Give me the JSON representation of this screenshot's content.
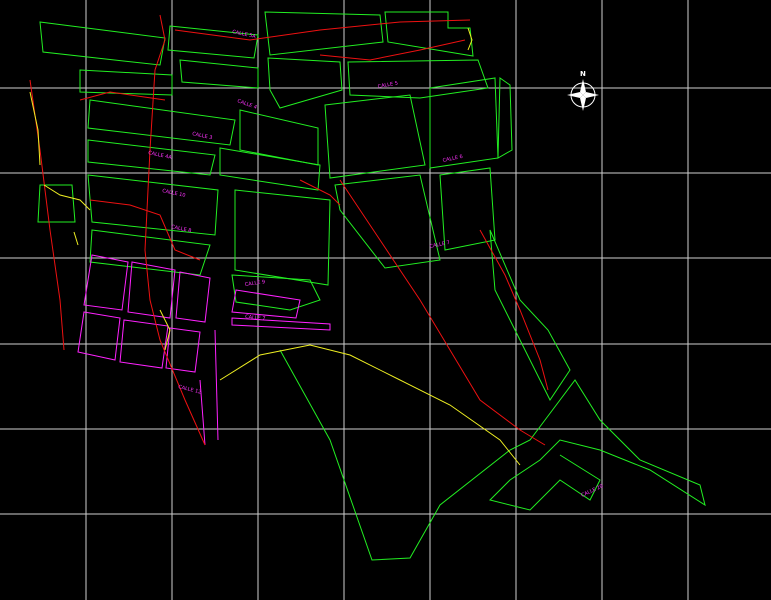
{
  "map": {
    "background": "#000000",
    "colors": {
      "grid": "#cfcfcf",
      "blocks": "#22ee22",
      "blocks_south": "#ff22ff",
      "road_red": "#ee1111",
      "road_yellow": "#eeee22",
      "labels": "#ff33ff",
      "compass": "#ffffff"
    },
    "compass": {
      "north_label": "N",
      "icon": "compass-rose-icon"
    },
    "street_labels": [
      "CALLE 5A",
      "CALLE 5",
      "CALLE 6",
      "CALLE 4",
      "CALLE 3",
      "CALLE 4A",
      "CALLE 10",
      "CALLE 7",
      "CALLE 8",
      "CALLE 9",
      "CALLE 7",
      "CALLE 12",
      "CALLE 20"
    ]
  }
}
